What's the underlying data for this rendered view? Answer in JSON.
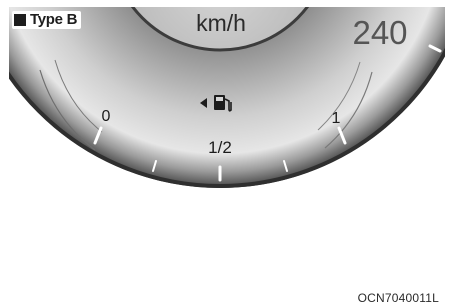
{
  "badge": {
    "label": "Type B",
    "icon": "black-square-icon"
  },
  "gauge": {
    "speed_unit": "km/h",
    "speed_max_label": "240",
    "fuel_empty_label": "0",
    "fuel_half_label": "1/2",
    "fuel_full_label": "1",
    "fuel_icon": "fuel-pump-icon",
    "fuel_arrow_icon": "left-arrow-icon"
  },
  "figure_code": "OCN7040011L",
  "colors": {
    "dial_dark": "#2e2e2e",
    "dial_mid": "#9a9a9a",
    "dial_light": "#d8d8d8",
    "text_dark": "#1c1c1c",
    "needle_white": "#ffffff"
  }
}
